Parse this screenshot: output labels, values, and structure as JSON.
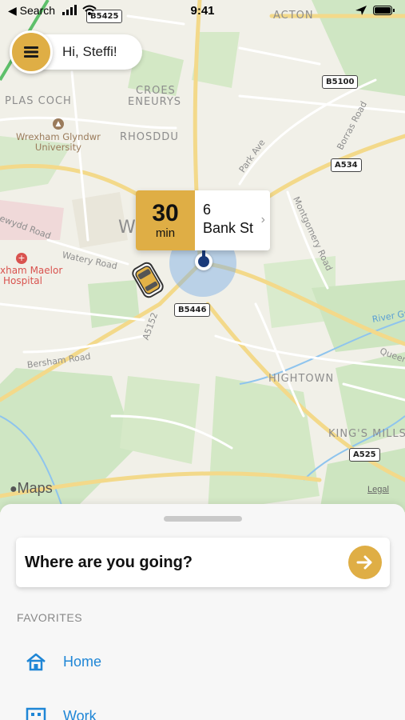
{
  "status_bar": {
    "back_label": "Search",
    "time": "9:41"
  },
  "greeting": {
    "text": "Hi, Steffi!"
  },
  "eta": {
    "minutes": "30",
    "unit": "min",
    "address_line1": "6",
    "address_line2": "Bank St"
  },
  "map": {
    "labels": {
      "acton": "ACTON",
      "croes": "CROES",
      "eneurys": "ENEURYS",
      "plas_coch": "PLAS COCH",
      "rhosddu": "RHOSDDU",
      "hightown": "HIGHTOWN",
      "kings_mills": "KING'S MILLS",
      "park_ave": "Park Ave",
      "borras_road": "Borras Road",
      "montgomery_road": "Montgomery Road",
      "watery_road": "Watery Road",
      "ewydd_road": "ewydd Road",
      "bersham_road": "Bersham Road",
      "a5152": "A5152",
      "river_gwenfro": "River Gw",
      "queen": "Queen",
      "town_fragment": "W",
      "university_line1": "Wrexham Glyndwr",
      "university_line2": "University",
      "hospital_line1": "xham Maelor",
      "hospital_line2": "Hospital"
    },
    "shields": {
      "b5425": "B5425",
      "b5100": "B5100",
      "a534": "A534",
      "b5446": "B5446",
      "a525": "A525"
    },
    "attribution": "Maps",
    "legal": "Legal"
  },
  "sheet": {
    "search_label": "Where are you going?",
    "favorites_title": "FAVORITES",
    "favorites": [
      {
        "label": "Home",
        "icon": "home-icon"
      },
      {
        "label": "Work",
        "icon": "work-icon"
      }
    ]
  },
  "colors": {
    "accent": "#DFAE45",
    "link": "#1F86D6",
    "location": "#1A3A7A"
  }
}
